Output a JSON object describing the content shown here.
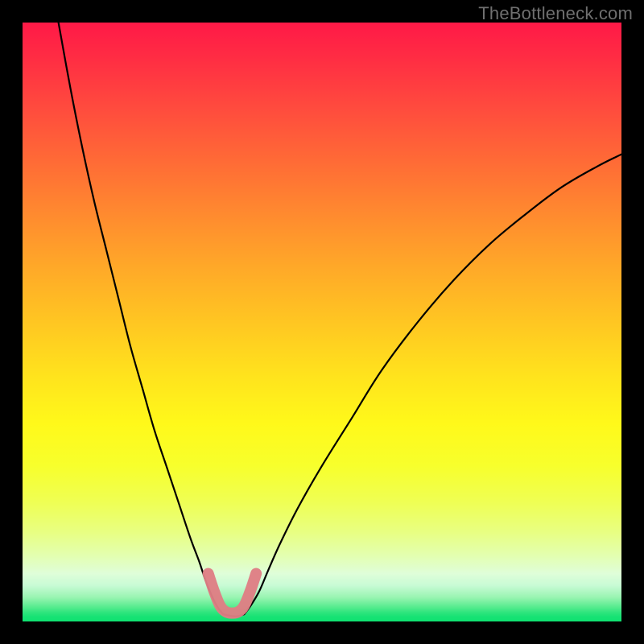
{
  "watermark": "TheBottleneck.com",
  "chart_data": {
    "type": "line",
    "title": "",
    "xlabel": "",
    "ylabel": "",
    "xlim": [
      0,
      100
    ],
    "ylim": [
      0,
      100
    ],
    "grid": false,
    "legend": false,
    "note": "Axes are unlabeled in the image; values are normalized 0–100 estimated from pixel positions.",
    "series": [
      {
        "name": "left-branch",
        "x": [
          6,
          8,
          10,
          12,
          14,
          16,
          18,
          20,
          22,
          24,
          26,
          28,
          29.5,
          30.5,
          31.5,
          32.5,
          33.5
        ],
        "y": [
          100,
          89,
          79,
          70,
          62,
          54,
          46,
          39,
          32,
          26,
          20,
          14,
          10,
          7,
          4.5,
          2.5,
          1.2
        ]
      },
      {
        "name": "right-branch",
        "x": [
          37,
          38,
          39.5,
          41,
          43,
          46,
          50,
          55,
          60,
          66,
          72,
          78,
          84,
          90,
          96,
          100
        ],
        "y": [
          1.2,
          2.5,
          5,
          8.5,
          13,
          19,
          26,
          34,
          42,
          50,
          57,
          63,
          68,
          72.5,
          76,
          78
        ]
      },
      {
        "name": "bottom-flat",
        "x": [
          33.5,
          35,
          36,
          37
        ],
        "y": [
          1.2,
          0.9,
          0.9,
          1.2
        ]
      },
      {
        "name": "pink-marker",
        "style": "thick",
        "color": "#df7e84",
        "x": [
          31,
          32,
          33,
          34,
          35,
          36,
          37,
          38,
          39
        ],
        "y": [
          8,
          5,
          2.6,
          1.6,
          1.4,
          1.6,
          2.6,
          5,
          8
        ]
      }
    ]
  }
}
